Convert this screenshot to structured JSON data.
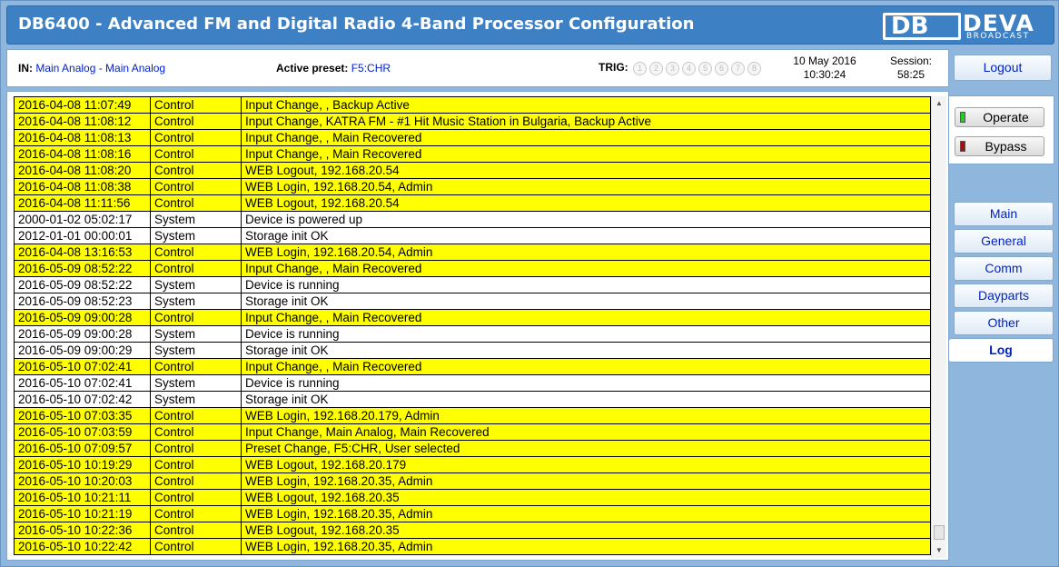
{
  "header": {
    "title": "DB6400 - Advanced FM and Digital Radio 4-Band Processor Configuration",
    "logo_mark": "DB",
    "logo_word": "DEVA",
    "logo_sub": "BROADCAST"
  },
  "status": {
    "in_label": "IN:",
    "in_value": "Main Analog - Main Analog",
    "preset_label": "Active preset:",
    "preset_value": "F5:CHR",
    "trig_label": "TRIG:",
    "trig_items": [
      "1",
      "2",
      "3",
      "4",
      "5",
      "6",
      "7",
      "8"
    ],
    "date": "10 May 2016",
    "time": "10:30:24",
    "session_label": "Session:",
    "session_value": "58:25"
  },
  "buttons": {
    "logout": "Logout",
    "operate": "Operate",
    "bypass": "Bypass"
  },
  "nav": {
    "main": "Main",
    "general": "General",
    "comm": "Comm",
    "dayparts": "Dayparts",
    "other": "Other",
    "log": "Log"
  },
  "log": {
    "rows": [
      {
        "time": "2016-04-08 11:07:49",
        "src": "Control",
        "msg": "Input Change, , Backup Active"
      },
      {
        "time": "2016-04-08 11:08:12",
        "src": "Control",
        "msg": "Input Change, KATRA FM - #1 Hit Music Station in Bulgaria, Backup Active"
      },
      {
        "time": "2016-04-08 11:08:13",
        "src": "Control",
        "msg": "Input Change, , Main Recovered"
      },
      {
        "time": "2016-04-08 11:08:16",
        "src": "Control",
        "msg": "Input Change, , Main Recovered"
      },
      {
        "time": "2016-04-08 11:08:20",
        "src": "Control",
        "msg": "WEB Logout, 192.168.20.54"
      },
      {
        "time": "2016-04-08 11:08:38",
        "src": "Control",
        "msg": "WEB Login, 192.168.20.54, Admin"
      },
      {
        "time": "2016-04-08 11:11:56",
        "src": "Control",
        "msg": "WEB Logout, 192.168.20.54"
      },
      {
        "time": "2000-01-02 05:02:17",
        "src": "System",
        "msg": "Device is powered up"
      },
      {
        "time": "2012-01-01 00:00:01",
        "src": "System",
        "msg": "Storage init OK"
      },
      {
        "time": "2016-04-08 13:16:53",
        "src": "Control",
        "msg": "WEB Login, 192.168.20.54, Admin"
      },
      {
        "time": "2016-05-09 08:52:22",
        "src": "Control",
        "msg": "Input Change, , Main Recovered"
      },
      {
        "time": "2016-05-09 08:52:22",
        "src": "System",
        "msg": "Device is running"
      },
      {
        "time": "2016-05-09 08:52:23",
        "src": "System",
        "msg": "Storage init OK"
      },
      {
        "time": "2016-05-09 09:00:28",
        "src": "Control",
        "msg": "Input Change, , Main Recovered"
      },
      {
        "time": "2016-05-09 09:00:28",
        "src": "System",
        "msg": "Device is running"
      },
      {
        "time": "2016-05-09 09:00:29",
        "src": "System",
        "msg": "Storage init OK"
      },
      {
        "time": "2016-05-10 07:02:41",
        "src": "Control",
        "msg": "Input Change, , Main Recovered"
      },
      {
        "time": "2016-05-10 07:02:41",
        "src": "System",
        "msg": "Device is running"
      },
      {
        "time": "2016-05-10 07:02:42",
        "src": "System",
        "msg": "Storage init OK"
      },
      {
        "time": "2016-05-10 07:03:35",
        "src": "Control",
        "msg": "WEB Login, 192.168.20.179, Admin"
      },
      {
        "time": "2016-05-10 07:03:59",
        "src": "Control",
        "msg": "Input Change, Main Analog, Main Recovered"
      },
      {
        "time": "2016-05-10 07:09:57",
        "src": "Control",
        "msg": "Preset Change, F5:CHR, User selected"
      },
      {
        "time": "2016-05-10 10:19:29",
        "src": "Control",
        "msg": "WEB Logout, 192.168.20.179"
      },
      {
        "time": "2016-05-10 10:20:03",
        "src": "Control",
        "msg": "WEB Login, 192.168.20.35, Admin"
      },
      {
        "time": "2016-05-10 10:21:11",
        "src": "Control",
        "msg": "WEB Logout, 192.168.20.35"
      },
      {
        "time": "2016-05-10 10:21:19",
        "src": "Control",
        "msg": "WEB Login, 192.168.20.35, Admin"
      },
      {
        "time": "2016-05-10 10:22:36",
        "src": "Control",
        "msg": "WEB Logout, 192.168.20.35"
      },
      {
        "time": "2016-05-10 10:22:42",
        "src": "Control",
        "msg": "WEB Login, 192.168.20.35, Admin"
      }
    ]
  },
  "colors": {
    "title_bg": "#3e80c4",
    "frame_bg": "#8fb7de",
    "control_row": "#ffff00",
    "link_blue": "#0022cc",
    "operate_led": "#22cc22",
    "bypass_led": "#a01010"
  }
}
